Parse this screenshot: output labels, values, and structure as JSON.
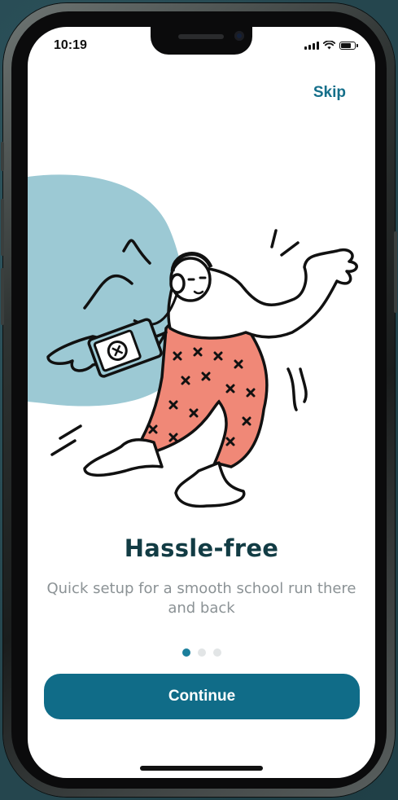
{
  "status_bar": {
    "time": "10:19"
  },
  "header": {
    "skip_label": "Skip"
  },
  "onboarding": {
    "title": "Hassle-free",
    "subtitle": "Quick setup for a smooth school run there and back",
    "page_count": 3,
    "active_page": 1
  },
  "actions": {
    "continue_label": "Continue"
  },
  "icons": {
    "signal": "cellular-signal-icon",
    "wifi": "wifi-icon",
    "battery": "battery-icon"
  },
  "colors": {
    "accent": "#106c88",
    "title": "#123c44",
    "blob": "#9cc9d4",
    "pants": "#f08877"
  }
}
